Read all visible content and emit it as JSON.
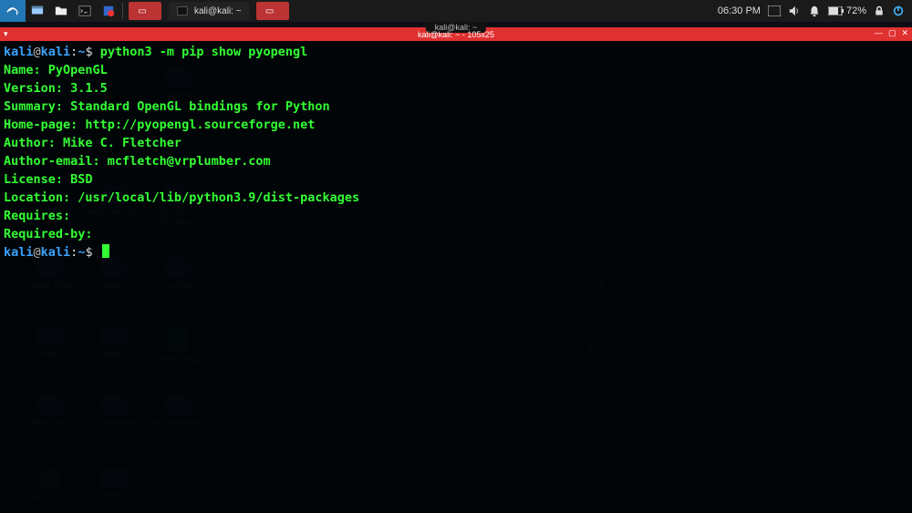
{
  "panel": {
    "clock": "06:30 PM",
    "battery_pct": "72%",
    "taskbar": {
      "win1_label": "",
      "win2_label": "kali@kali: ~",
      "win3_label": ""
    }
  },
  "desktop": {
    "icons": [
      {
        "label": "tplmap"
      },
      {
        "label": "Article Tools"
      },
      {
        "label": "webscreenshot"
      },
      {
        "label": "operative-framework"
      },
      {
        "label": "altair"
      },
      {
        "label": "leviathan"
      },
      {
        "label": "naabu"
      },
      {
        "label": "tulpar"
      },
      {
        "label": "sqlmap.tar.gz"
      },
      {
        "label": "ghost_eye"
      },
      {
        "label": "webvulnscan"
      },
      {
        "label": "sqlmapproject-sqlmap-3b07b70"
      },
      {
        "label": "WPCracker"
      },
      {
        "label": "Blazy"
      }
    ]
  },
  "terminal": {
    "tab_label": "kali@kali: ~",
    "title": "kali@kali: ~ - 105x25",
    "prompt": {
      "user": "kali",
      "at": "@",
      "host": "kali",
      "colon": ":",
      "path": "~",
      "dollar": "$"
    },
    "command": "python3 -m pip show pyopengl",
    "output": [
      "Name: PyOpenGL",
      "Version: 3.1.5",
      "Summary: Standard OpenGL bindings for Python",
      "Home-page: http://pyopengl.sourceforge.net",
      "Author: Mike C. Fletcher",
      "Author-email: mcfletch@vrplumber.com",
      "License: BSD",
      "Location: /usr/local/lib/python3.9/dist-packages",
      "Requires: ",
      "Required-by: "
    ]
  }
}
